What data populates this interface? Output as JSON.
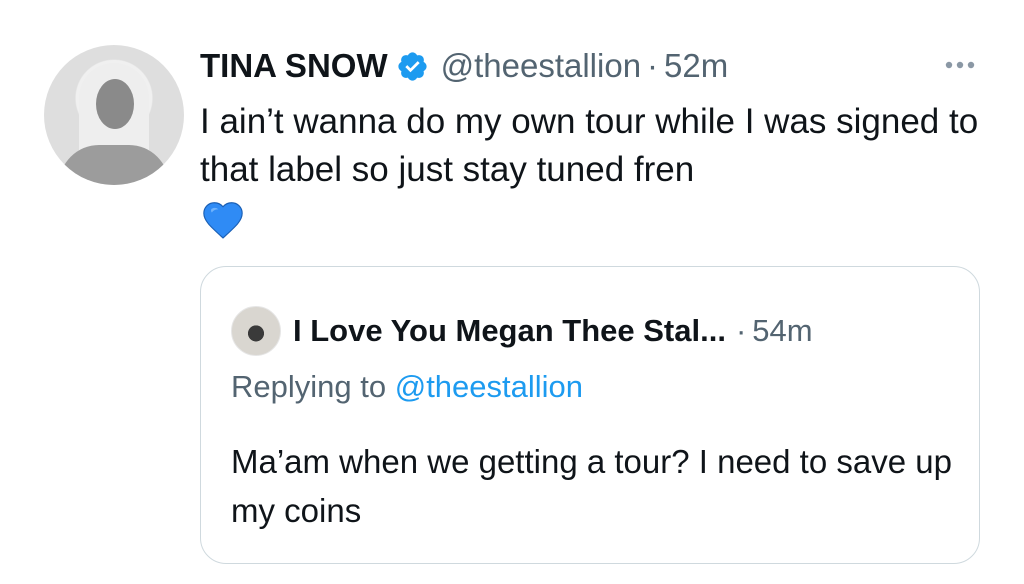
{
  "tweet": {
    "author_name": "TINA SNOW",
    "handle": "@theestallion",
    "separator": "·",
    "time": "52m",
    "text": "I ain’t wanna do my own tour while I was signed to that label so just stay tuned fren",
    "emoji": "blue-heart"
  },
  "quoted": {
    "author_name": "I Love You Megan Thee Stal...",
    "separator": "·",
    "time": "54m",
    "replying_prefix": "Replying to",
    "replying_to": "@theestallion",
    "text": "Ma’am when we getting a tour? I need to save up my coins"
  },
  "colors": {
    "text": "#0f1419",
    "secondary": "#536471",
    "accent": "#1d9bf0",
    "heart": "#2f8bf5",
    "border": "#cfd9de"
  }
}
